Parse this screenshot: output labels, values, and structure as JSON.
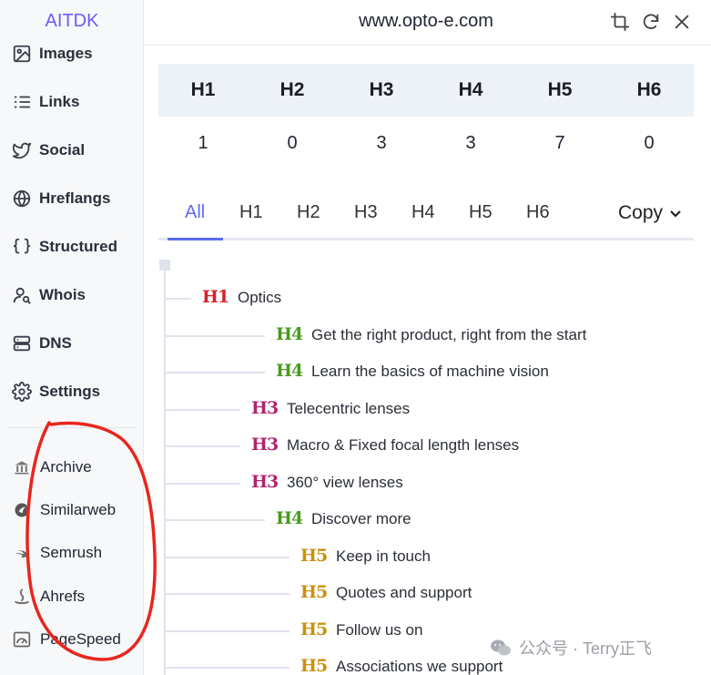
{
  "sidebar": {
    "brand": "AITDK",
    "nav": [
      {
        "label": "Images",
        "icon": "image-icon"
      },
      {
        "label": "Links",
        "icon": "list-icon"
      },
      {
        "label": "Social",
        "icon": "twitter-icon"
      },
      {
        "label": "Hreflangs",
        "icon": "globe-icon"
      },
      {
        "label": "Structured",
        "icon": "braces-icon"
      },
      {
        "label": "Whois",
        "icon": "user-search-icon"
      },
      {
        "label": "DNS",
        "icon": "server-icon"
      },
      {
        "label": "Settings",
        "icon": "gear-icon"
      }
    ],
    "external": [
      {
        "label": "Archive",
        "icon": "archive-icon"
      },
      {
        "label": "Similarweb",
        "icon": "similarweb-icon"
      },
      {
        "label": "Semrush",
        "icon": "semrush-icon"
      },
      {
        "label": "Ahrefs",
        "icon": "ahrefs-icon"
      },
      {
        "label": "PageSpeed",
        "icon": "speedometer-icon"
      }
    ]
  },
  "header": {
    "domain": "www.opto-e.com",
    "buttons": [
      "crop-icon",
      "refresh-icon",
      "close-icon"
    ]
  },
  "counts": {
    "headers": [
      "H1",
      "H2",
      "H3",
      "H4",
      "H5",
      "H6"
    ],
    "values": [
      "1",
      "0",
      "3",
      "3",
      "7",
      "0"
    ]
  },
  "tabs": {
    "items": [
      "All",
      "H1",
      "H2",
      "H3",
      "H4",
      "H5",
      "H6"
    ],
    "active": "All",
    "copy_label": "Copy"
  },
  "outline": [
    {
      "level": "H1",
      "text": "Optics"
    },
    {
      "level": "H4",
      "text": "Get the right product, right from the start"
    },
    {
      "level": "H4",
      "text": "Learn the basics of machine vision"
    },
    {
      "level": "H3",
      "text": "Telecentric lenses"
    },
    {
      "level": "H3",
      "text": "Macro & Fixed focal length lenses"
    },
    {
      "level": "H3",
      "text": "360° view lenses"
    },
    {
      "level": "H4",
      "text": "Discover more"
    },
    {
      "level": "H5",
      "text": "Keep in touch"
    },
    {
      "level": "H5",
      "text": "Quotes and support"
    },
    {
      "level": "H5",
      "text": "Follow us on"
    },
    {
      "level": "H5",
      "text": "Associations we support"
    }
  ],
  "level_colors": {
    "H1": "#d9202c",
    "H3": "#b3246e",
    "H4": "#4a9a1c",
    "H5": "#c89210"
  },
  "colors": {
    "accent": "#5b6cf0",
    "brand": "#6b5cf5",
    "annotation": "#e8261e"
  },
  "watermark": "公众号 · Terry正飞"
}
